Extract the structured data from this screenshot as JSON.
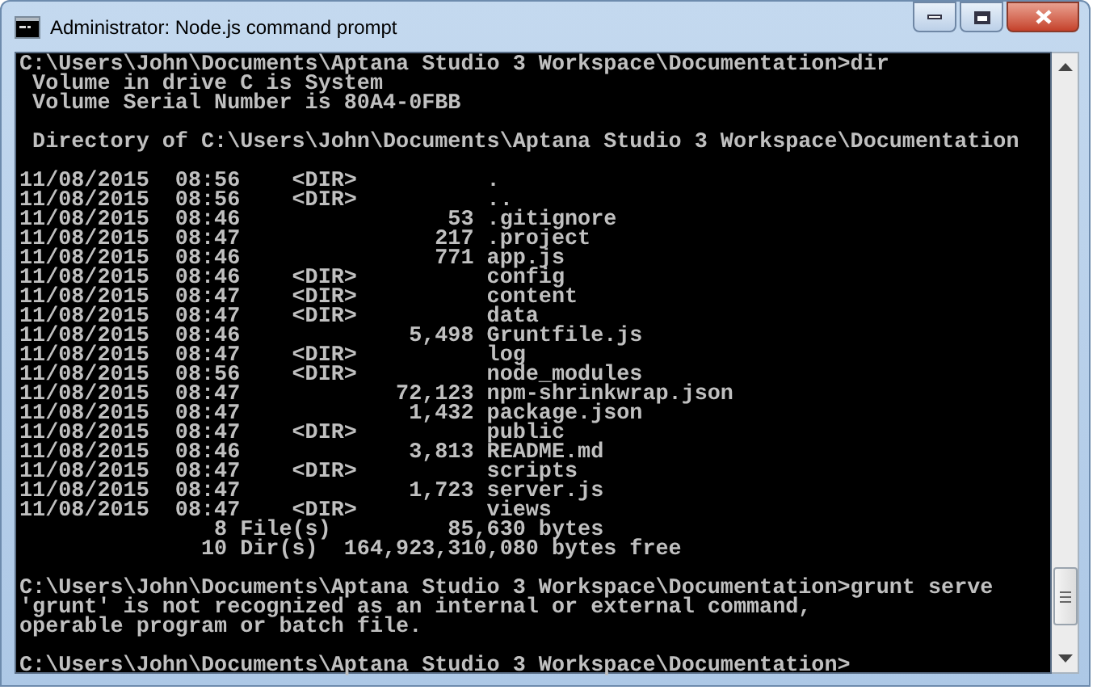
{
  "window": {
    "title": "Administrator: Node.js command prompt"
  },
  "console": {
    "blocks": [
      [
        "C:\\Users\\John\\Documents\\Aptana Studio 3 Workspace\\Documentation>dir",
        " Volume in drive C is System",
        " Volume Serial Number is 80A4-0FBB"
      ],
      [
        " Directory of C:\\Users\\John\\Documents\\Aptana Studio 3 Workspace\\Documentation"
      ],
      [
        "11/08/2015  08:56    <DIR>          .",
        "11/08/2015  08:56    <DIR>          ..",
        "11/08/2015  08:46                53 .gitignore",
        "11/08/2015  08:47               217 .project",
        "11/08/2015  08:46               771 app.js",
        "11/08/2015  08:46    <DIR>          config",
        "11/08/2015  08:47    <DIR>          content",
        "11/08/2015  08:47    <DIR>          data",
        "11/08/2015  08:46             5,498 Gruntfile.js",
        "11/08/2015  08:47    <DIR>          log",
        "11/08/2015  08:56    <DIR>          node_modules",
        "11/08/2015  08:47            72,123 npm-shrinkwrap.json",
        "11/08/2015  08:47             1,432 package.json",
        "11/08/2015  08:47    <DIR>          public",
        "11/08/2015  08:46             3,813 README.md",
        "11/08/2015  08:47    <DIR>          scripts",
        "11/08/2015  08:47             1,723 server.js",
        "11/08/2015  08:47    <DIR>          views",
        "               8 File(s)         85,630 bytes",
        "              10 Dir(s)  164,923,310,080 bytes free"
      ],
      [
        "C:\\Users\\John\\Documents\\Aptana Studio 3 Workspace\\Documentation>grunt serve",
        "'grunt' is not recognized as an internal or external command,",
        "operable program or batch file."
      ],
      [
        "C:\\Users\\John\\Documents\\Aptana Studio 3 Workspace\\Documentation>"
      ]
    ]
  }
}
